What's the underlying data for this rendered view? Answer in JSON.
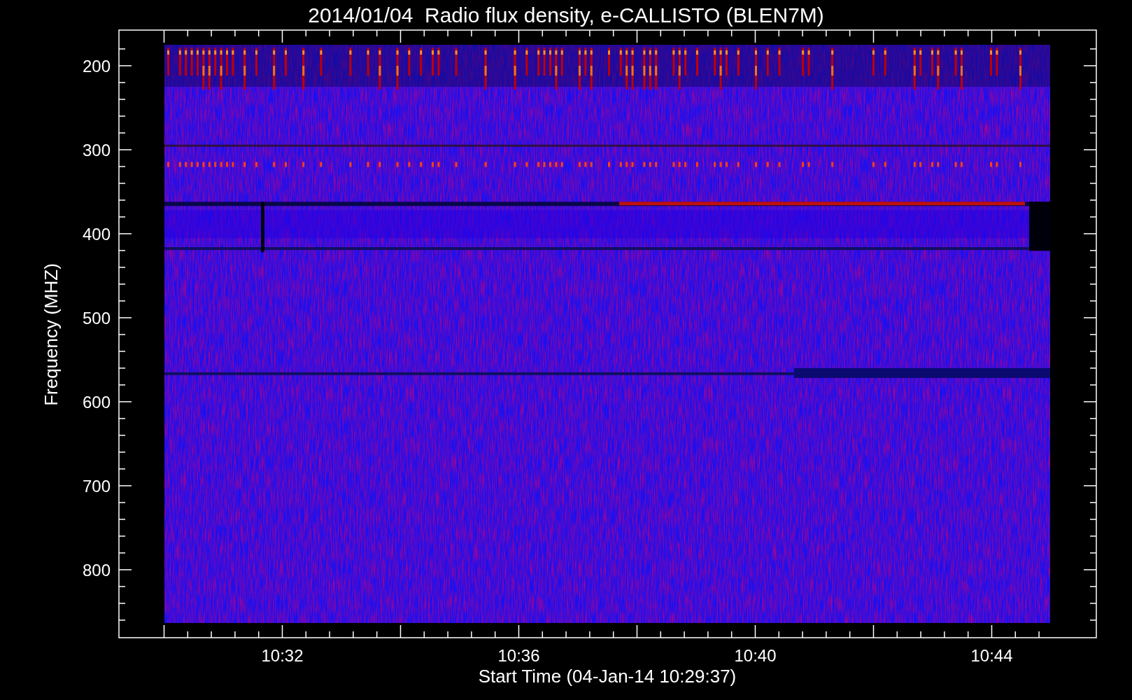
{
  "title": "2014/01/04  Radio flux density, e-CALLISTO (BLEN7M)",
  "y_axis": {
    "label": "Frequency (MHZ)",
    "ticks": [
      "200",
      "300",
      "400",
      "500",
      "600",
      "700",
      "800"
    ]
  },
  "x_axis": {
    "label": "Start Time (04-Jan-14 10:29:37)",
    "ticks": [
      "10:32",
      "10:36",
      "10:40",
      "10:44"
    ]
  }
}
